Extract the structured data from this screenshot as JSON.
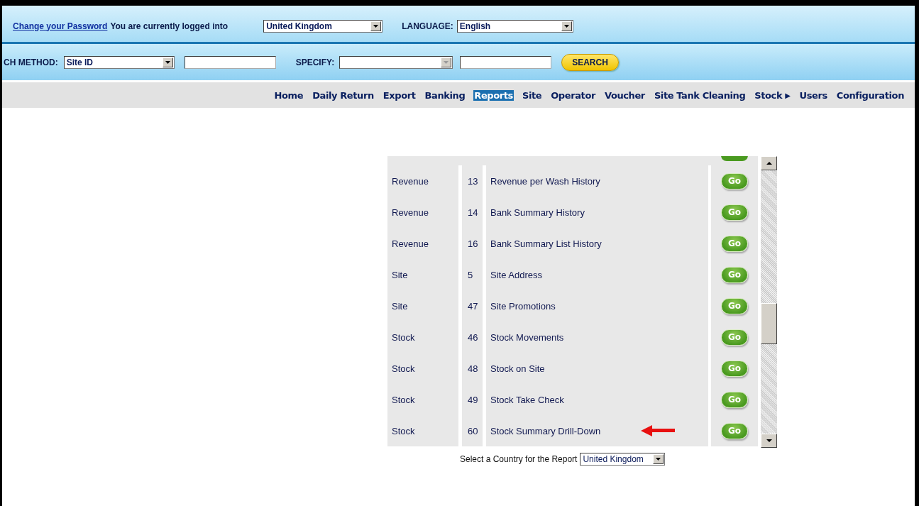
{
  "header": {
    "password_link": "Change your Password",
    "login_text": "You are currently logged into",
    "country_select": {
      "value": "United Kingdom"
    },
    "language_label": "LANGUAGE:",
    "language_select": {
      "value": "English"
    }
  },
  "search_bar": {
    "method_label": "CH METHOD:",
    "method_select": {
      "value": "Site ID"
    },
    "specify_label": "SPECIFY:",
    "specify_select": {
      "disabled": true
    },
    "search_button": "SEARCH"
  },
  "nav": [
    {
      "label": "Home",
      "selected": false
    },
    {
      "label": "Daily Return",
      "selected": false
    },
    {
      "label": "Export",
      "selected": false
    },
    {
      "label": "Banking",
      "selected": false
    },
    {
      "label": "Reports",
      "selected": true
    },
    {
      "label": "Site",
      "selected": false
    },
    {
      "label": "Operator",
      "selected": false
    },
    {
      "label": "Voucher",
      "selected": false
    },
    {
      "label": "Site Tank Cleaning",
      "selected": false
    },
    {
      "label": "Stock",
      "selected": false,
      "submenu_arrow": "▶"
    },
    {
      "label": "Users",
      "selected": false
    },
    {
      "label": "Configuration",
      "selected": false
    }
  ],
  "reports": {
    "rows": [
      {
        "category": "Revenue",
        "number": "13",
        "title": "Revenue per Wash History",
        "action": "Go",
        "highlighted": false
      },
      {
        "category": "Revenue",
        "number": "14",
        "title": "Bank Summary History",
        "action": "Go",
        "highlighted": false
      },
      {
        "category": "Revenue",
        "number": "16",
        "title": "Bank Summary List History",
        "action": "Go",
        "highlighted": false
      },
      {
        "category": "Site",
        "number": "5",
        "title": "Site Address",
        "action": "Go",
        "highlighted": false
      },
      {
        "category": "Site",
        "number": "47",
        "title": "Site Promotions",
        "action": "Go",
        "highlighted": false
      },
      {
        "category": "Stock",
        "number": "46",
        "title": "Stock Movements",
        "action": "Go",
        "highlighted": false
      },
      {
        "category": "Stock",
        "number": "48",
        "title": "Stock on Site",
        "action": "Go",
        "highlighted": false
      },
      {
        "category": "Stock",
        "number": "49",
        "title": "Stock Take Check",
        "action": "Go",
        "highlighted": false
      },
      {
        "category": "Stock",
        "number": "60",
        "title": "Stock Summary Drill-Down",
        "action": "Go",
        "highlighted": true
      }
    ]
  },
  "country_filter": {
    "label": "Select a Country for the Report",
    "select": {
      "value": "United Kingdom"
    }
  }
}
